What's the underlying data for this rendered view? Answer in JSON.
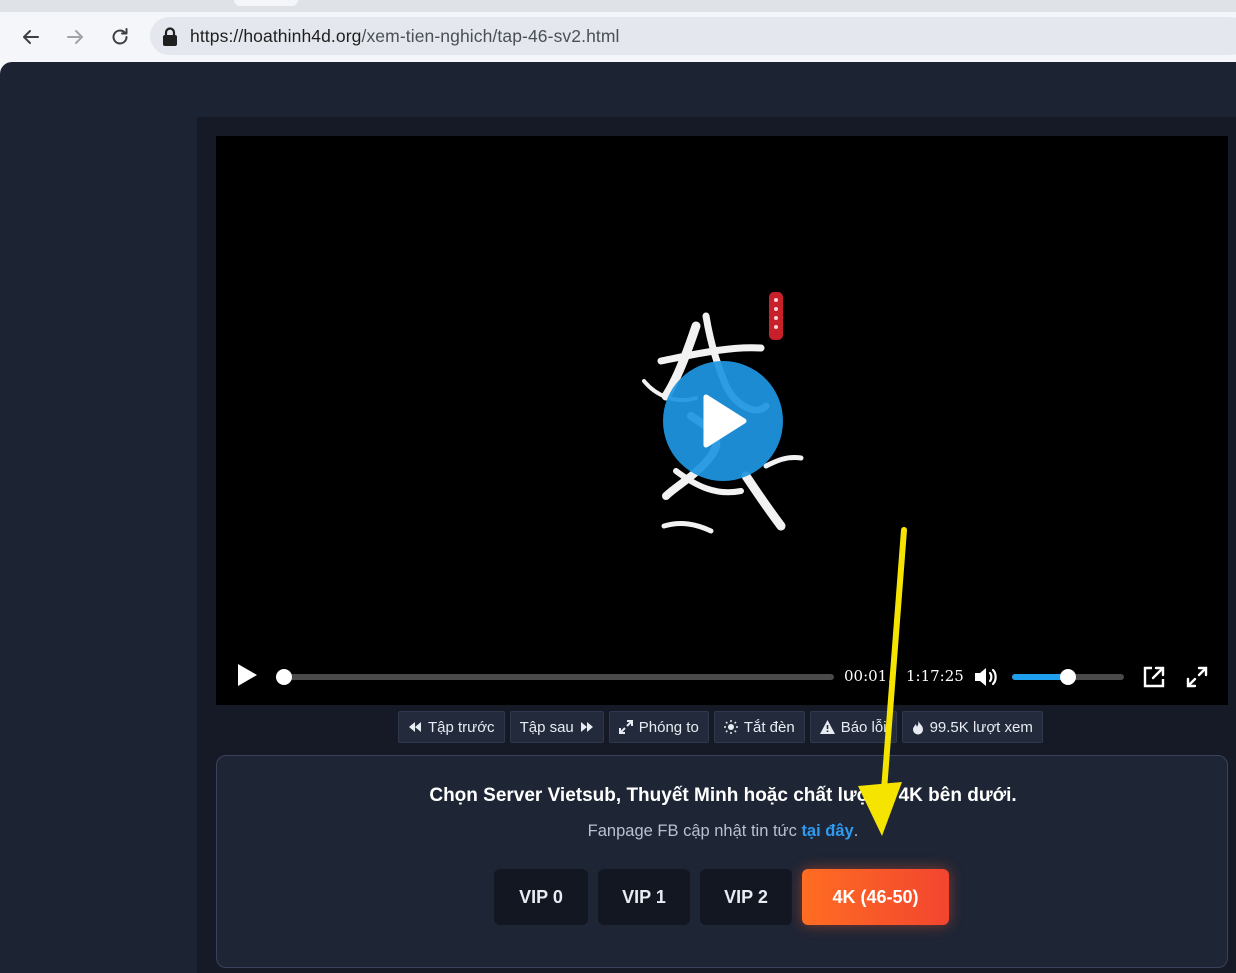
{
  "browser": {
    "url_host": "https://hoathinh4d.org",
    "url_path": "/xem-tien-nghich/tap-46-sv2.html"
  },
  "player": {
    "current_time": "00:01",
    "separator": "/",
    "duration": "1:17:25",
    "progress_fraction": 0.0002,
    "volume_fraction": 0.5
  },
  "actions": [
    {
      "label": "Tập trước",
      "icon": "backward-icon"
    },
    {
      "label": "Tập sau",
      "icon": "forward-icon"
    },
    {
      "label": "Phóng to",
      "icon": "expand-icon"
    },
    {
      "label": "Tắt đèn",
      "icon": "light-icon"
    },
    {
      "label": "Báo lỗi",
      "icon": "warning-icon"
    },
    {
      "label": "99.5K lượt xem",
      "icon": "fire-icon"
    }
  ],
  "server_box": {
    "title": "Chọn Server Vietsub, Thuyết Minh hoặc chất lượng 4K bên dưới.",
    "fanpage_text": "Fanpage FB cập nhật tin tức",
    "fanpage_link": "tại đây",
    "fanpage_end": ".",
    "servers": [
      "VIP 0",
      "VIP 1",
      "VIP 2",
      "4K (46-50)"
    ]
  },
  "colors": {
    "accent_blue": "#2e9bf0",
    "active_server": "#ff6d22",
    "annotation_arrow": "#f5e400"
  }
}
